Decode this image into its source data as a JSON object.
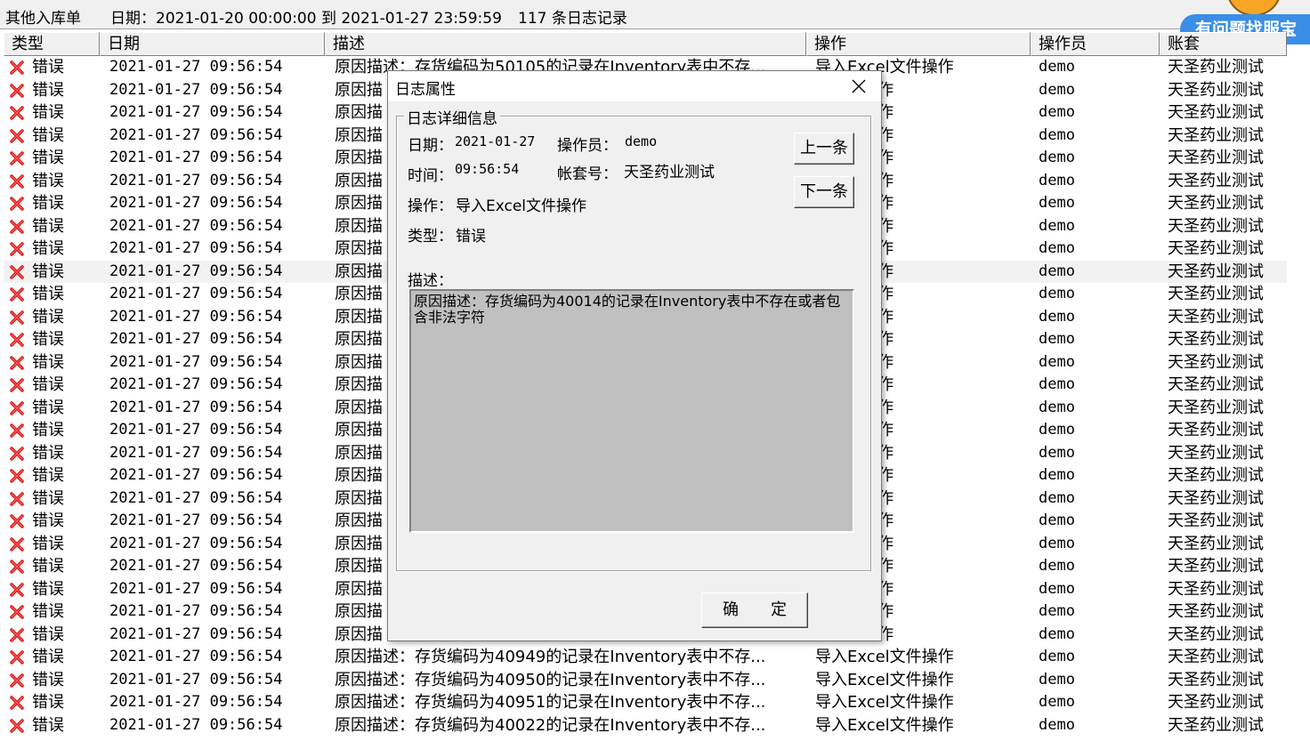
{
  "topbar": {
    "title": "其他入库单",
    "date_range": "日期：2021-01-20 00:00:00 到 2021-01-27 23:59:59",
    "record_count": "117 条日志记录"
  },
  "help": {
    "label": "有问题找服宝"
  },
  "columns": [
    "类型",
    "日期",
    "描述",
    "操作",
    "操作员",
    "账套"
  ],
  "rows": [
    {
      "type": "错误",
      "date": "2021-01-27 09:56:54",
      "desc": "原因描述：存货编码为50105的记录在Inventory表中不存...",
      "op": "导入Excel文件操作",
      "user": "demo",
      "acct": "天圣药业测试"
    },
    {
      "type": "错误",
      "date": "2021-01-27 09:56:54",
      "desc": "原因描",
      "op": "el文件操作",
      "user": "demo",
      "acct": "天圣药业测试"
    },
    {
      "type": "错误",
      "date": "2021-01-27 09:56:54",
      "desc": "原因描",
      "op": "el文件操作",
      "user": "demo",
      "acct": "天圣药业测试"
    },
    {
      "type": "错误",
      "date": "2021-01-27 09:56:54",
      "desc": "原因描",
      "op": "el文件操作",
      "user": "demo",
      "acct": "天圣药业测试"
    },
    {
      "type": "错误",
      "date": "2021-01-27 09:56:54",
      "desc": "原因描",
      "op": "el文件操作",
      "user": "demo",
      "acct": "天圣药业测试"
    },
    {
      "type": "错误",
      "date": "2021-01-27 09:56:54",
      "desc": "原因描",
      "op": "el文件操作",
      "user": "demo",
      "acct": "天圣药业测试"
    },
    {
      "type": "错误",
      "date": "2021-01-27 09:56:54",
      "desc": "原因描",
      "op": "el文件操作",
      "user": "demo",
      "acct": "天圣药业测试"
    },
    {
      "type": "错误",
      "date": "2021-01-27 09:56:54",
      "desc": "原因描",
      "op": "el文件操作",
      "user": "demo",
      "acct": "天圣药业测试"
    },
    {
      "type": "错误",
      "date": "2021-01-27 09:56:54",
      "desc": "原因描",
      "op": "el文件操作",
      "user": "demo",
      "acct": "天圣药业测试"
    },
    {
      "type": "错误",
      "date": "2021-01-27 09:56:54",
      "desc": "原因描",
      "op": "el文件操作",
      "user": "demo",
      "acct": "天圣药业测试",
      "selected": true
    },
    {
      "type": "错误",
      "date": "2021-01-27 09:56:54",
      "desc": "原因描",
      "op": "el文件操作",
      "user": "demo",
      "acct": "天圣药业测试"
    },
    {
      "type": "错误",
      "date": "2021-01-27 09:56:54",
      "desc": "原因描",
      "op": "el文件操作",
      "user": "demo",
      "acct": "天圣药业测试"
    },
    {
      "type": "错误",
      "date": "2021-01-27 09:56:54",
      "desc": "原因描",
      "op": "el文件操作",
      "user": "demo",
      "acct": "天圣药业测试"
    },
    {
      "type": "错误",
      "date": "2021-01-27 09:56:54",
      "desc": "原因描",
      "op": "el文件操作",
      "user": "demo",
      "acct": "天圣药业测试"
    },
    {
      "type": "错误",
      "date": "2021-01-27 09:56:54",
      "desc": "原因描",
      "op": "el文件操作",
      "user": "demo",
      "acct": "天圣药业测试"
    },
    {
      "type": "错误",
      "date": "2021-01-27 09:56:54",
      "desc": "原因描",
      "op": "el文件操作",
      "user": "demo",
      "acct": "天圣药业测试"
    },
    {
      "type": "错误",
      "date": "2021-01-27 09:56:54",
      "desc": "原因描",
      "op": "el文件操作",
      "user": "demo",
      "acct": "天圣药业测试"
    },
    {
      "type": "错误",
      "date": "2021-01-27 09:56:54",
      "desc": "原因描",
      "op": "el文件操作",
      "user": "demo",
      "acct": "天圣药业测试"
    },
    {
      "type": "错误",
      "date": "2021-01-27 09:56:54",
      "desc": "原因描",
      "op": "el文件操作",
      "user": "demo",
      "acct": "天圣药业测试"
    },
    {
      "type": "错误",
      "date": "2021-01-27 09:56:54",
      "desc": "原因描",
      "op": "el文件操作",
      "user": "demo",
      "acct": "天圣药业测试"
    },
    {
      "type": "错误",
      "date": "2021-01-27 09:56:54",
      "desc": "原因描",
      "op": "el文件操作",
      "user": "demo",
      "acct": "天圣药业测试"
    },
    {
      "type": "错误",
      "date": "2021-01-27 09:56:54",
      "desc": "原因描",
      "op": "el文件操作",
      "user": "demo",
      "acct": "天圣药业测试"
    },
    {
      "type": "错误",
      "date": "2021-01-27 09:56:54",
      "desc": "原因描",
      "op": "el文件操作",
      "user": "demo",
      "acct": "天圣药业测试"
    },
    {
      "type": "错误",
      "date": "2021-01-27 09:56:54",
      "desc": "原因描",
      "op": "el文件操作",
      "user": "demo",
      "acct": "天圣药业测试"
    },
    {
      "type": "错误",
      "date": "2021-01-27 09:56:54",
      "desc": "原因描",
      "op": "el文件操作",
      "user": "demo",
      "acct": "天圣药业测试"
    },
    {
      "type": "错误",
      "date": "2021-01-27 09:56:54",
      "desc": "原因描",
      "op": "el文件操作",
      "user": "demo",
      "acct": "天圣药业测试"
    },
    {
      "type": "错误",
      "date": "2021-01-27 09:56:54",
      "desc": "原因描述：存货编码为40949的记录在Inventory表中不存...",
      "op": "导入Excel文件操作",
      "user": "demo",
      "acct": "天圣药业测试"
    },
    {
      "type": "错误",
      "date": "2021-01-27 09:56:54",
      "desc": "原因描述：存货编码为40950的记录在Inventory表中不存...",
      "op": "导入Excel文件操作",
      "user": "demo",
      "acct": "天圣药业测试"
    },
    {
      "type": "错误",
      "date": "2021-01-27 09:56:54",
      "desc": "原因描述：存货编码为40951的记录在Inventory表中不存...",
      "op": "导入Excel文件操作",
      "user": "demo",
      "acct": "天圣药业测试"
    },
    {
      "type": "错误",
      "date": "2021-01-27 09:56:54",
      "desc": "原因描述：存货编码为40022的记录在Inventory表中不存...",
      "op": "导入Excel文件操作",
      "user": "demo",
      "acct": "天圣药业测试"
    }
  ],
  "dialog": {
    "title": "日志属性",
    "group_label": "日志详细信息",
    "date_label": "日期：",
    "date_value": "2021-01-27",
    "operator_label": "操作员：",
    "operator_value": "demo",
    "time_label": "时间：",
    "time_value": "09:56:54",
    "account_label": "帐套号：",
    "account_value": "天圣药业测试",
    "operation_label": "操作：",
    "operation_value": "导入Excel文件操作",
    "type_label": "类型：",
    "type_value": "错误",
    "desc_label": "描述：",
    "desc_text": "原因描述：存货编码为40014的记录在Inventory表中不存在或者包含非法字符",
    "prev_button": "上一条",
    "next_button": "下一条",
    "ok_button": "确　　定"
  }
}
